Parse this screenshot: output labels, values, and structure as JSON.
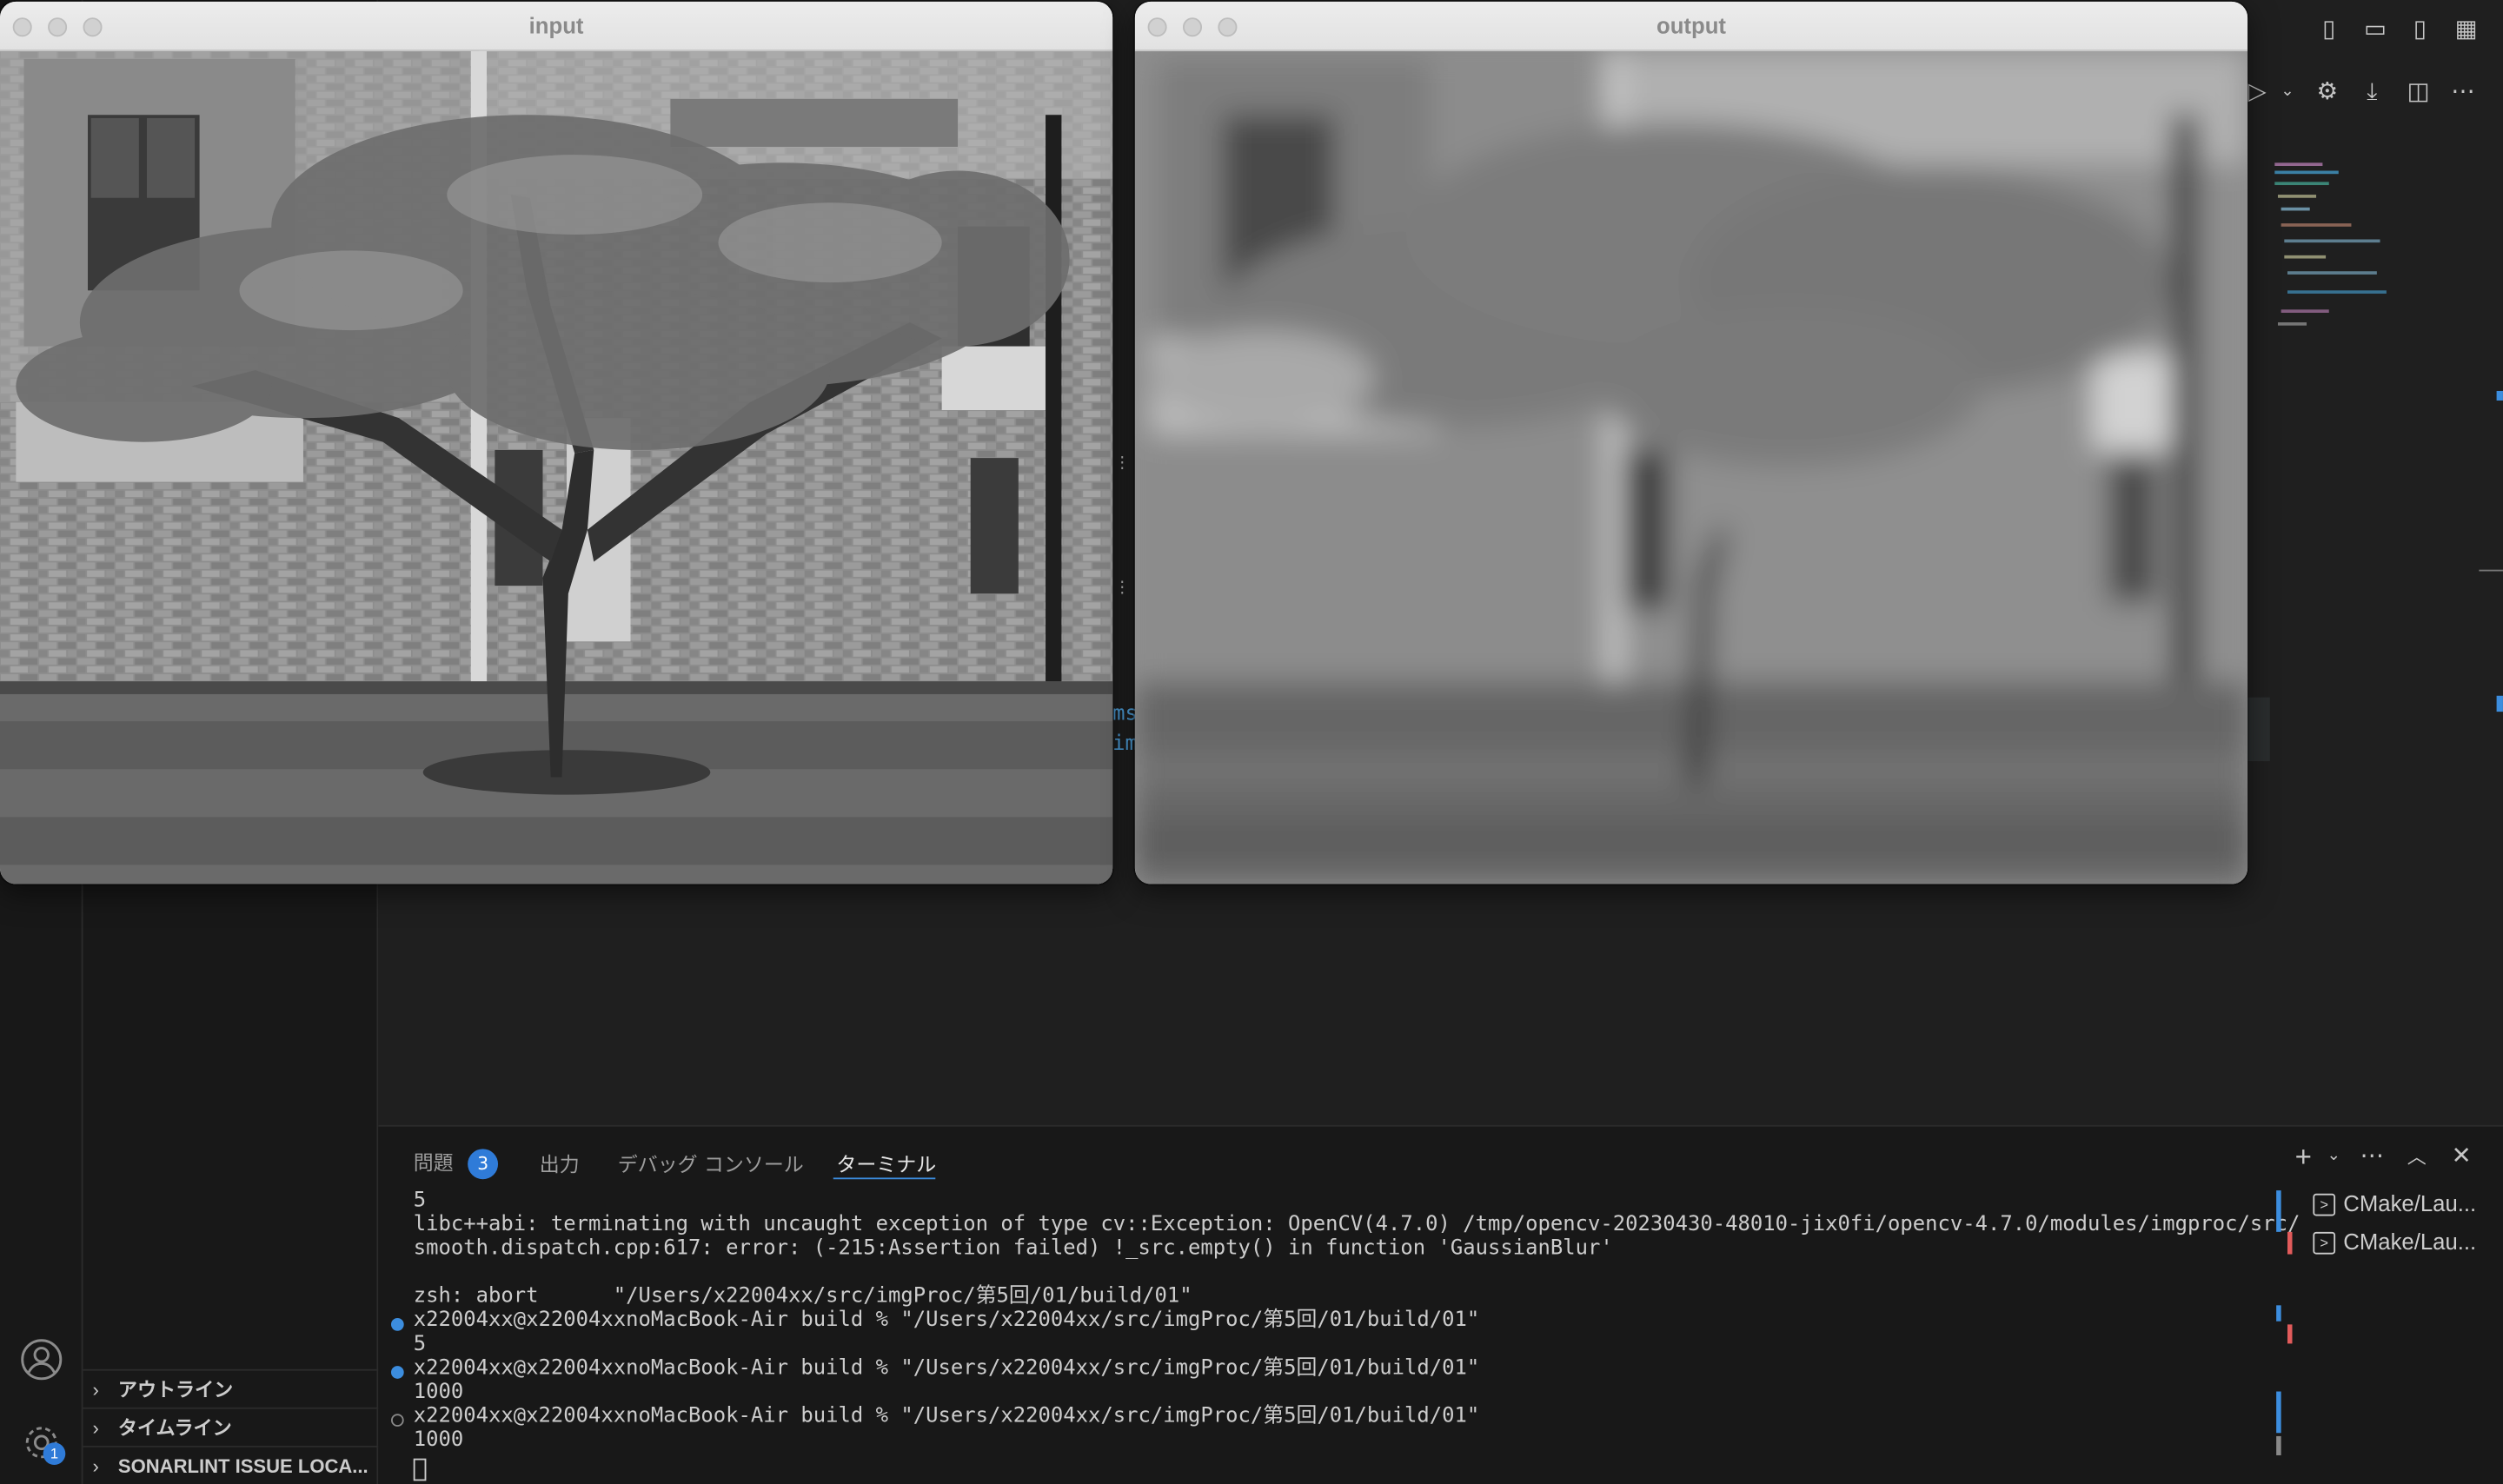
{
  "windows": {
    "input": {
      "title": "input"
    },
    "output": {
      "title": "output"
    }
  },
  "sidebar": {
    "sections": [
      {
        "label": "アウトライン"
      },
      {
        "label": "タイムライン"
      },
      {
        "label": "SONARLINT ISSUE LOCA..."
      }
    ]
  },
  "activity_bar": {
    "settings_badge": "1"
  },
  "panel": {
    "tabs": [
      {
        "label": "問題",
        "badge": "3"
      },
      {
        "label": "出力"
      },
      {
        "label": "デバッグ コンソール"
      },
      {
        "label": "ターミナル"
      }
    ],
    "active_tab": "ターミナル",
    "terminal_lines": [
      "5",
      "libc++abi: terminating with uncaught exception of type cv::Exception: OpenCV(4.7.0) /tmp/opencv-20230430-48010-jix0fi/opencv-4.7.0/modules/imgproc/src/",
      "smooth.dispatch.cpp:617: error: (-215:Assertion failed) !_src.empty() in function 'GaussianBlur'",
      "",
      "zsh: abort      \"/Users/x22004xx/src/imgProc/第5回/01/build/01\"",
      "x22004xx@x22004xxnoMacBook-Air build % \"/Users/x22004xx/src/imgProc/第5回/01/build/01\"",
      "5",
      "x22004xx@x22004xxnoMacBook-Air build % \"/Users/x22004xx/src/imgProc/第5回/01/build/01\"",
      "1000",
      "x22004xx@x22004xxnoMacBook-Air build % \"/Users/x22004xx/src/imgProc/第5回/01/build/01\"",
      "1000"
    ],
    "terminal_instances": [
      {
        "label": "CMake/Lau..."
      },
      {
        "label": "CMake/Lau..."
      }
    ]
  },
  "editor_fragments": {
    "line1": "ms",
    "line2": "im"
  },
  "colors": {
    "accent": "#3c8dde",
    "badge": "#2f7bd8",
    "error": "#e25b5b"
  }
}
